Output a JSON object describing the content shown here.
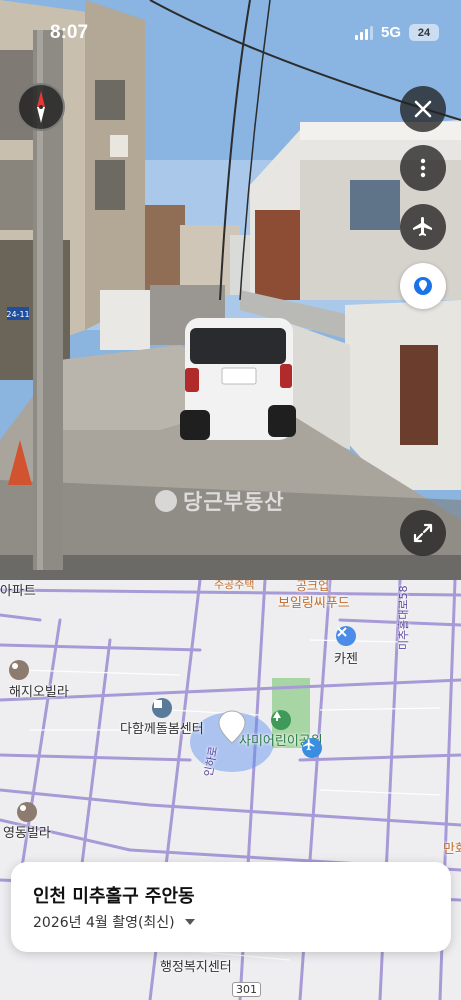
{
  "status_bar": {
    "time": "8:07",
    "network": "5G",
    "battery": "24"
  },
  "street_view": {
    "watermark_text": "당근부동산",
    "address_plate": "24-11",
    "controls": {
      "compass_icon": "compass-icon",
      "close_icon": "close-icon",
      "more_icon": "more-vertical-icon",
      "airplane_icon": "airplane-icon",
      "location_icon": "location-pin-icon",
      "expand_icon": "expand-icon"
    }
  },
  "map": {
    "labels": {
      "apartment": "아파트",
      "top_partial": "주공주택",
      "shop_top": "공크업",
      "boiler": "보일링씨푸드",
      "road_vertical": "미추홀대로58",
      "cafe": "카젠",
      "villa_left": "해지오빌라",
      "center": "다함께돌봄센터",
      "park": "사미어린이공원",
      "road_small": "인하로",
      "villa_bottom": "영동빌라",
      "right_edge": "만화",
      "admin_center": "행정복지센터",
      "number": "301"
    }
  },
  "card": {
    "title": "인천 미추홀구 주안동",
    "subtitle": "2026년 4월 촬영(최신)"
  },
  "colors": {
    "accent_blue": "#1a73e8",
    "map_road": "#a79ad6",
    "park_green": "#a8d5a4"
  }
}
